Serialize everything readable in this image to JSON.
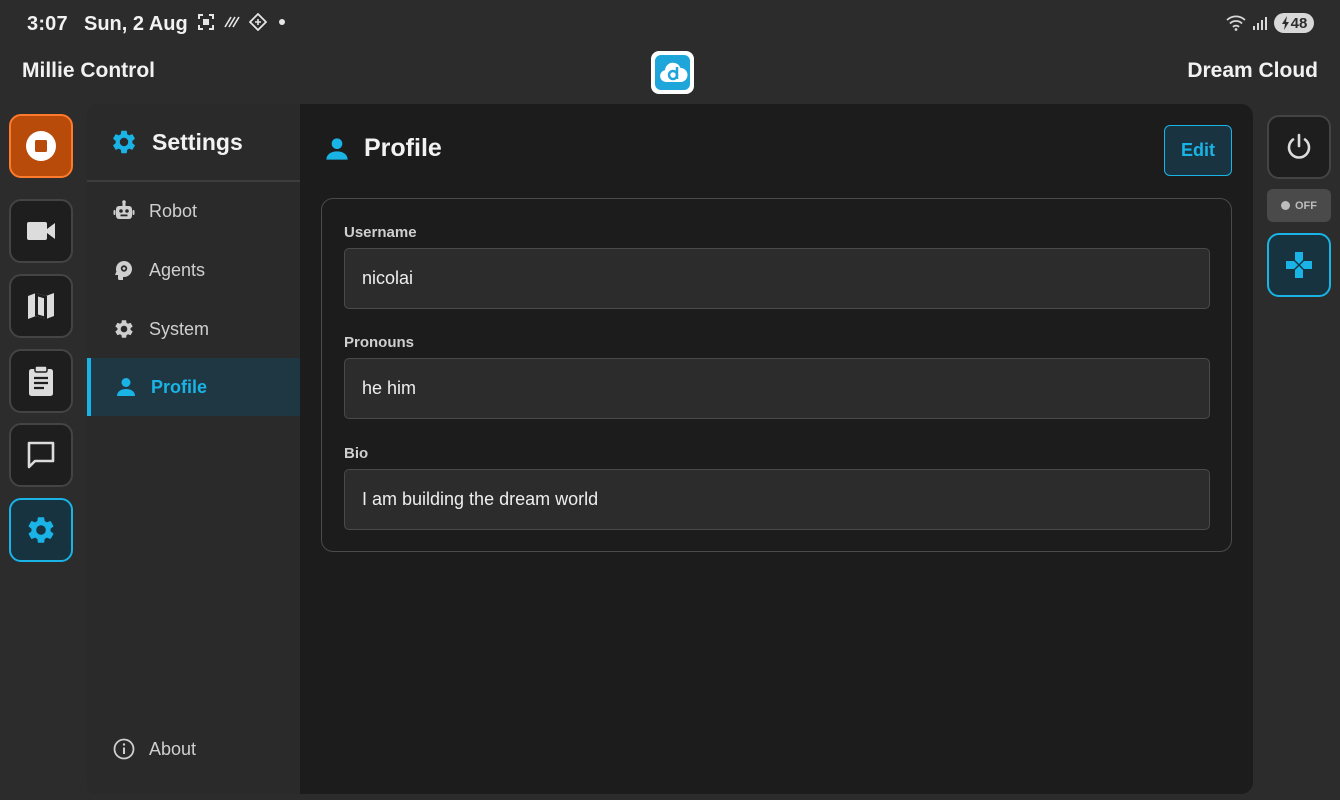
{
  "status_bar": {
    "time": "3:07",
    "date": "Sun, 2 Aug",
    "battery": "48",
    "icons_left": [
      "screenshot-icon",
      "slash-icon",
      "diamond-icon",
      "dot-icon"
    ],
    "icons_right": [
      "wifi-icon",
      "signal-icon",
      "battery-icon"
    ]
  },
  "header": {
    "app_title": "Millie Control",
    "cloud_name": "Dream Cloud",
    "logo_icon": "dream-cloud-logo-icon"
  },
  "left_rail": [
    {
      "name": "stop-button",
      "icon": "stop-icon",
      "state": "alert"
    },
    {
      "name": "camera-button",
      "icon": "video-camera-icon"
    },
    {
      "name": "map-button",
      "icon": "map-icon"
    },
    {
      "name": "tasks-button",
      "icon": "clipboard-icon"
    },
    {
      "name": "chat-button",
      "icon": "chat-icon"
    },
    {
      "name": "settings-button",
      "icon": "gear-icon",
      "state": "active"
    }
  ],
  "sidebar": {
    "title": "Settings",
    "items": [
      {
        "label": "Robot",
        "icon": "robot-icon"
      },
      {
        "label": "Agents",
        "icon": "agent-head-icon"
      },
      {
        "label": "System",
        "icon": "gear-icon"
      },
      {
        "label": "Profile",
        "icon": "person-icon",
        "active": true
      }
    ],
    "footer": {
      "label": "About",
      "icon": "info-icon"
    }
  },
  "profile": {
    "title": "Profile",
    "edit_label": "Edit",
    "fields": [
      {
        "label": "Username",
        "value": "nicolai"
      },
      {
        "label": "Pronouns",
        "value": "he him"
      },
      {
        "label": "Bio",
        "value": "I am building the dream world"
      }
    ]
  },
  "right_rail": {
    "power_icon": "power-icon",
    "toggle_label": "OFF",
    "gamepad_icon": "gamepad-icon"
  },
  "colors": {
    "accent": "#19b3e6",
    "stop": "#b84a0a",
    "background": "#2c2c2c",
    "panel": "#1c1c1c"
  }
}
